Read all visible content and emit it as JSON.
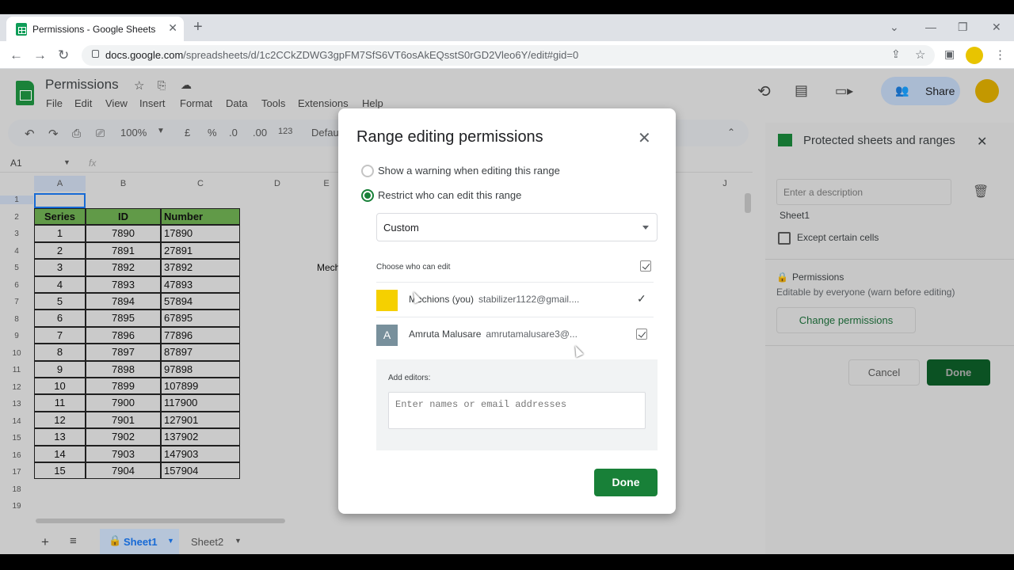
{
  "browser": {
    "tab_title": "Permissions - Google Sheets",
    "tab_close": "✕",
    "new_tab": "+",
    "url_domain": "docs.google.com",
    "url_path": "/spreadsheets/d/1c2CCkZDWG3gpFM7SfS6VT6osAkEQsstS0rGD2Vleo6Y/edit#gid=0"
  },
  "sheets": {
    "title": "Permissions",
    "menu": [
      "File",
      "Edit",
      "View",
      "Insert",
      "Format",
      "Data",
      "Tools",
      "Extensions",
      "Help"
    ],
    "zoom": "100%",
    "currency": "£",
    "percent": "%",
    "dec_less": ".0",
    "dec_more": ".00",
    "num_fmt": "123",
    "font": "Defau",
    "name_box": "A1",
    "fx": "fx",
    "share": "Share",
    "columns": [
      "A",
      "B",
      "C",
      "D",
      "E",
      "J"
    ],
    "rows": [
      "1",
      "2",
      "3",
      "4",
      "5",
      "6",
      "7",
      "8",
      "9",
      "10",
      "11",
      "12",
      "13",
      "14",
      "15",
      "16",
      "17",
      "18",
      "19"
    ],
    "table_headers": [
      "Series",
      "ID",
      "Number"
    ],
    "table_rows": [
      [
        "1",
        "7890",
        "17890"
      ],
      [
        "2",
        "7891",
        "27891"
      ],
      [
        "3",
        "7892",
        "37892"
      ],
      [
        "4",
        "7893",
        "47893"
      ],
      [
        "5",
        "7894",
        "57894"
      ],
      [
        "6",
        "7895",
        "67895"
      ],
      [
        "7",
        "7896",
        "77896"
      ],
      [
        "8",
        "7897",
        "87897"
      ],
      [
        "9",
        "7898",
        "97898"
      ],
      [
        "10",
        "7899",
        "107899"
      ],
      [
        "11",
        "7900",
        "117900"
      ],
      [
        "12",
        "7901",
        "127901"
      ],
      [
        "13",
        "7902",
        "137902"
      ],
      [
        "14",
        "7903",
        "147903"
      ],
      [
        "15",
        "7904",
        "157904"
      ]
    ],
    "e5_text": "Mech",
    "sheet_tabs": [
      "Sheet1",
      "Sheet2"
    ]
  },
  "side_panel": {
    "title": "Protected sheets and ranges",
    "description_placeholder": "Enter a description",
    "range_name": "Sheet1",
    "except_label": "Except certain cells",
    "perm_title": "Permissions",
    "perm_sub": "Editable by everyone (warn before editing)",
    "change_btn": "Change permissions",
    "cancel_btn": "Cancel",
    "done_btn": "Done"
  },
  "modal": {
    "title": "Range editing permissions",
    "close": "✕",
    "option_warn": "Show a warning when editing this range",
    "option_restrict": "Restrict who can edit this range",
    "select_value": "Custom",
    "choose_label": "Choose who can edit",
    "users": [
      {
        "name": "Mechions (you)",
        "email": "stabilizer1122@gmail....",
        "avatar_letter": ""
      },
      {
        "name": "Amruta Malusare",
        "email": "amrutamalusare3@...",
        "avatar_letter": "A"
      }
    ],
    "add_label": "Add editors:",
    "add_placeholder": "Enter names or email addresses",
    "done": "Done"
  }
}
